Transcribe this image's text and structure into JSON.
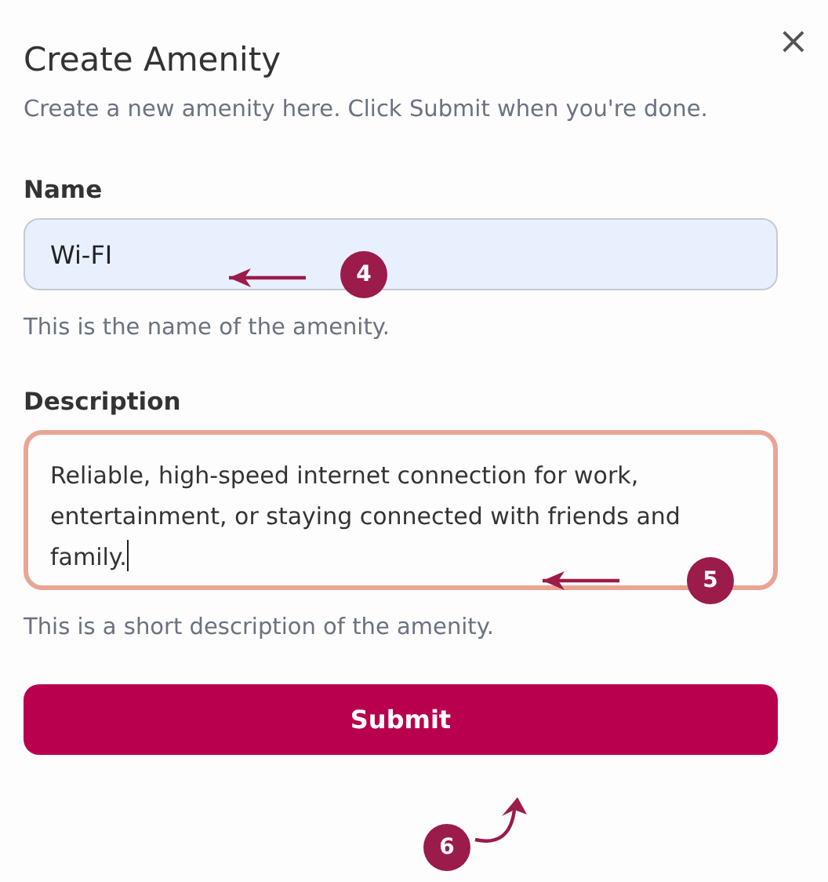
{
  "dialog": {
    "title": "Create Amenity",
    "description": "Create a new amenity here. Click Submit when you're done.",
    "close_icon": "×"
  },
  "fields": [
    {
      "kind": "input",
      "label": "Name",
      "value": "Wi-FI",
      "help": "This is the name of the amenity.",
      "focused": false
    },
    {
      "kind": "textarea",
      "label": "Description",
      "value": "Reliable, high-speed internet connection for work, entertainment, or staying connected with friends and family.",
      "help": "This is a short description of the amenity.",
      "focused": true
    }
  ],
  "submit_button": "Submit",
  "annotations": [
    {
      "number": "4"
    },
    {
      "number": "5"
    },
    {
      "number": "6"
    }
  ]
}
